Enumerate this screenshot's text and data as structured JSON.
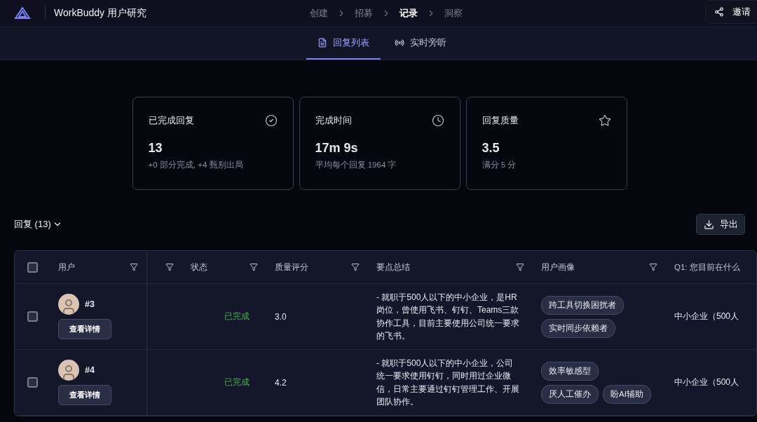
{
  "header": {
    "title": "WorkBuddy 用户研究",
    "steps": [
      {
        "label": "创建",
        "selected": false
      },
      {
        "label": "招募",
        "selected": false
      },
      {
        "label": "记录",
        "selected": true
      },
      {
        "label": "洞察",
        "selected": false
      }
    ],
    "invite": "邀请"
  },
  "tabs": [
    {
      "label": "回复列表",
      "kind": "list",
      "selected": true
    },
    {
      "label": "实时旁听",
      "kind": "live",
      "selected": false
    }
  ],
  "stats": [
    {
      "title": "已完成回复",
      "kind": "completed",
      "value": "13",
      "note": "+0 部分完成, +4 甄别出局"
    },
    {
      "title": "完成时间",
      "kind": "time",
      "value": "17m 9s",
      "note": "平均每个回复 1964 字"
    },
    {
      "title": "回复质量",
      "kind": "quality",
      "value": "3.5",
      "note": "满分 5 分"
    }
  ],
  "section": {
    "title": "回复 (13)",
    "export": "导出"
  },
  "table": {
    "select_all": {
      "checked": false
    },
    "columns": [
      {
        "label": "用户"
      },
      {},
      {
        "label": "状态"
      },
      {
        "label": "质量评分"
      },
      {
        "label": "要点总结"
      },
      {
        "label": "用户画像"
      },
      {
        "label": "Q1: 您目前在什么"
      }
    ],
    "rows": [
      {
        "checked": false,
        "user": "#3",
        "details": "查看详情",
        "status": "已完成",
        "score": "3.0",
        "summary": "- 就职于500人以下的中小企业，是HR岗位，曾使用飞书、钉钉、Teams三款协作工具，目前主要使用公司统一要求的飞书。",
        "tags": [
          "跨工具切换困扰者",
          "实时同步依赖者"
        ],
        "q1": "中小企业（500人"
      },
      {
        "checked": false,
        "user": "#4",
        "details": "查看详情",
        "status": "已完成",
        "score": "4.2",
        "summary": "- 就职于500人以下的中小企业，公司统一要求使用钉钉，同时用过企业微信，日常主要通过钉钉管理工作、开展团队协作。",
        "tags": [
          "效率敏感型",
          "厌人工催办",
          "盼AI辅助"
        ],
        "q1": "中小企业（500人"
      }
    ]
  }
}
